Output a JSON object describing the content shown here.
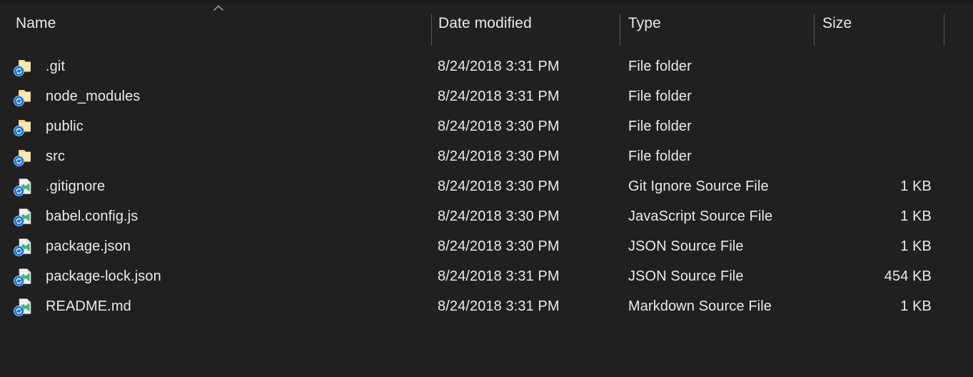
{
  "window": {
    "view": "details-list",
    "background_color": "#202020",
    "text_color": "#eaeaea"
  },
  "sort": {
    "column": "Name",
    "direction": "ascending",
    "icon": "chevron-up-icon"
  },
  "columns": [
    {
      "key": "name",
      "label": "Name"
    },
    {
      "key": "date_modified",
      "label": "Date modified"
    },
    {
      "key": "type",
      "label": "Type"
    },
    {
      "key": "size",
      "label": "Size"
    }
  ],
  "rows": [
    {
      "name": ".git",
      "date_modified": "8/24/2018 3:31 PM",
      "type": "File folder",
      "size": "",
      "icon": "folder-icon",
      "badge": "sync-badge-icon"
    },
    {
      "name": "node_modules",
      "date_modified": "8/24/2018 3:31 PM",
      "type": "File folder",
      "size": "",
      "icon": "folder-icon",
      "badge": "sync-badge-icon"
    },
    {
      "name": "public",
      "date_modified": "8/24/2018 3:30 PM",
      "type": "File folder",
      "size": "",
      "icon": "folder-icon",
      "badge": "sync-badge-icon"
    },
    {
      "name": "src",
      "date_modified": "8/24/2018 3:30 PM",
      "type": "File folder",
      "size": "",
      "icon": "folder-icon",
      "badge": "sync-badge-icon"
    },
    {
      "name": ".gitignore",
      "date_modified": "8/24/2018 3:30 PM",
      "type": "Git Ignore Source File",
      "size": "1 KB",
      "icon": "vscode-file-icon",
      "badge": "sync-badge-icon"
    },
    {
      "name": "babel.config.js",
      "date_modified": "8/24/2018 3:30 PM",
      "type": "JavaScript Source File",
      "size": "1 KB",
      "icon": "vscode-file-icon",
      "badge": "sync-badge-icon"
    },
    {
      "name": "package.json",
      "date_modified": "8/24/2018 3:30 PM",
      "type": "JSON Source File",
      "size": "1 KB",
      "icon": "vscode-file-icon",
      "badge": "sync-badge-icon"
    },
    {
      "name": "package-lock.json",
      "date_modified": "8/24/2018 3:31 PM",
      "type": "JSON Source File",
      "size": "454 KB",
      "icon": "vscode-file-icon",
      "badge": "sync-badge-icon"
    },
    {
      "name": "README.md",
      "date_modified": "8/24/2018 3:31 PM",
      "type": "Markdown Source File",
      "size": "1 KB",
      "icon": "vscode-file-icon",
      "badge": "sync-badge-icon"
    }
  ],
  "colors": {
    "folder": "#f3d689",
    "folder_light": "#fae8b4",
    "vscode_green": "#3cb371",
    "sync_blue": "#1b72d4",
    "divider": "#5a5a5a"
  }
}
